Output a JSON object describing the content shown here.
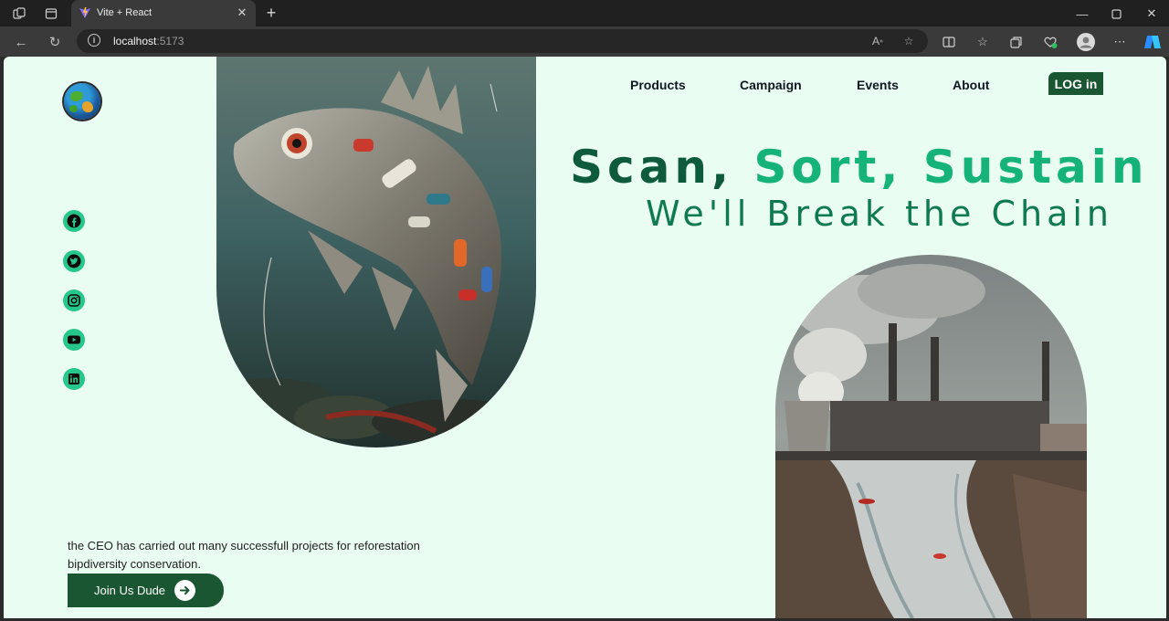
{
  "browser": {
    "tab_title": "Vite + React",
    "url_host": "localhost",
    "url_port": ":5173"
  },
  "nav": {
    "links": [
      "Products",
      "Campaign",
      "Events",
      "About"
    ],
    "login_label": "LOG in"
  },
  "hero": {
    "headline_word1": "Scan,",
    "headline_word2": "Sort,",
    "headline_word3": "Sustain",
    "subheadline": "We'll Break the Chain",
    "description_line1": "the CEO has carried out many successfull projects for reforestation",
    "description_line2": "bipdiversity conservation.",
    "cta_label": "Join Us Dude"
  },
  "social": [
    "facebook-icon",
    "twitter-icon",
    "instagram-icon",
    "youtube-icon",
    "linkedin-icon"
  ],
  "colors": {
    "page_background": "#e9fdf3",
    "accent_dark": "#1a5632",
    "accent_green": "#15b37a",
    "headline_dark": "#0e5a3c",
    "social_icon_bg": "#26c78a"
  }
}
